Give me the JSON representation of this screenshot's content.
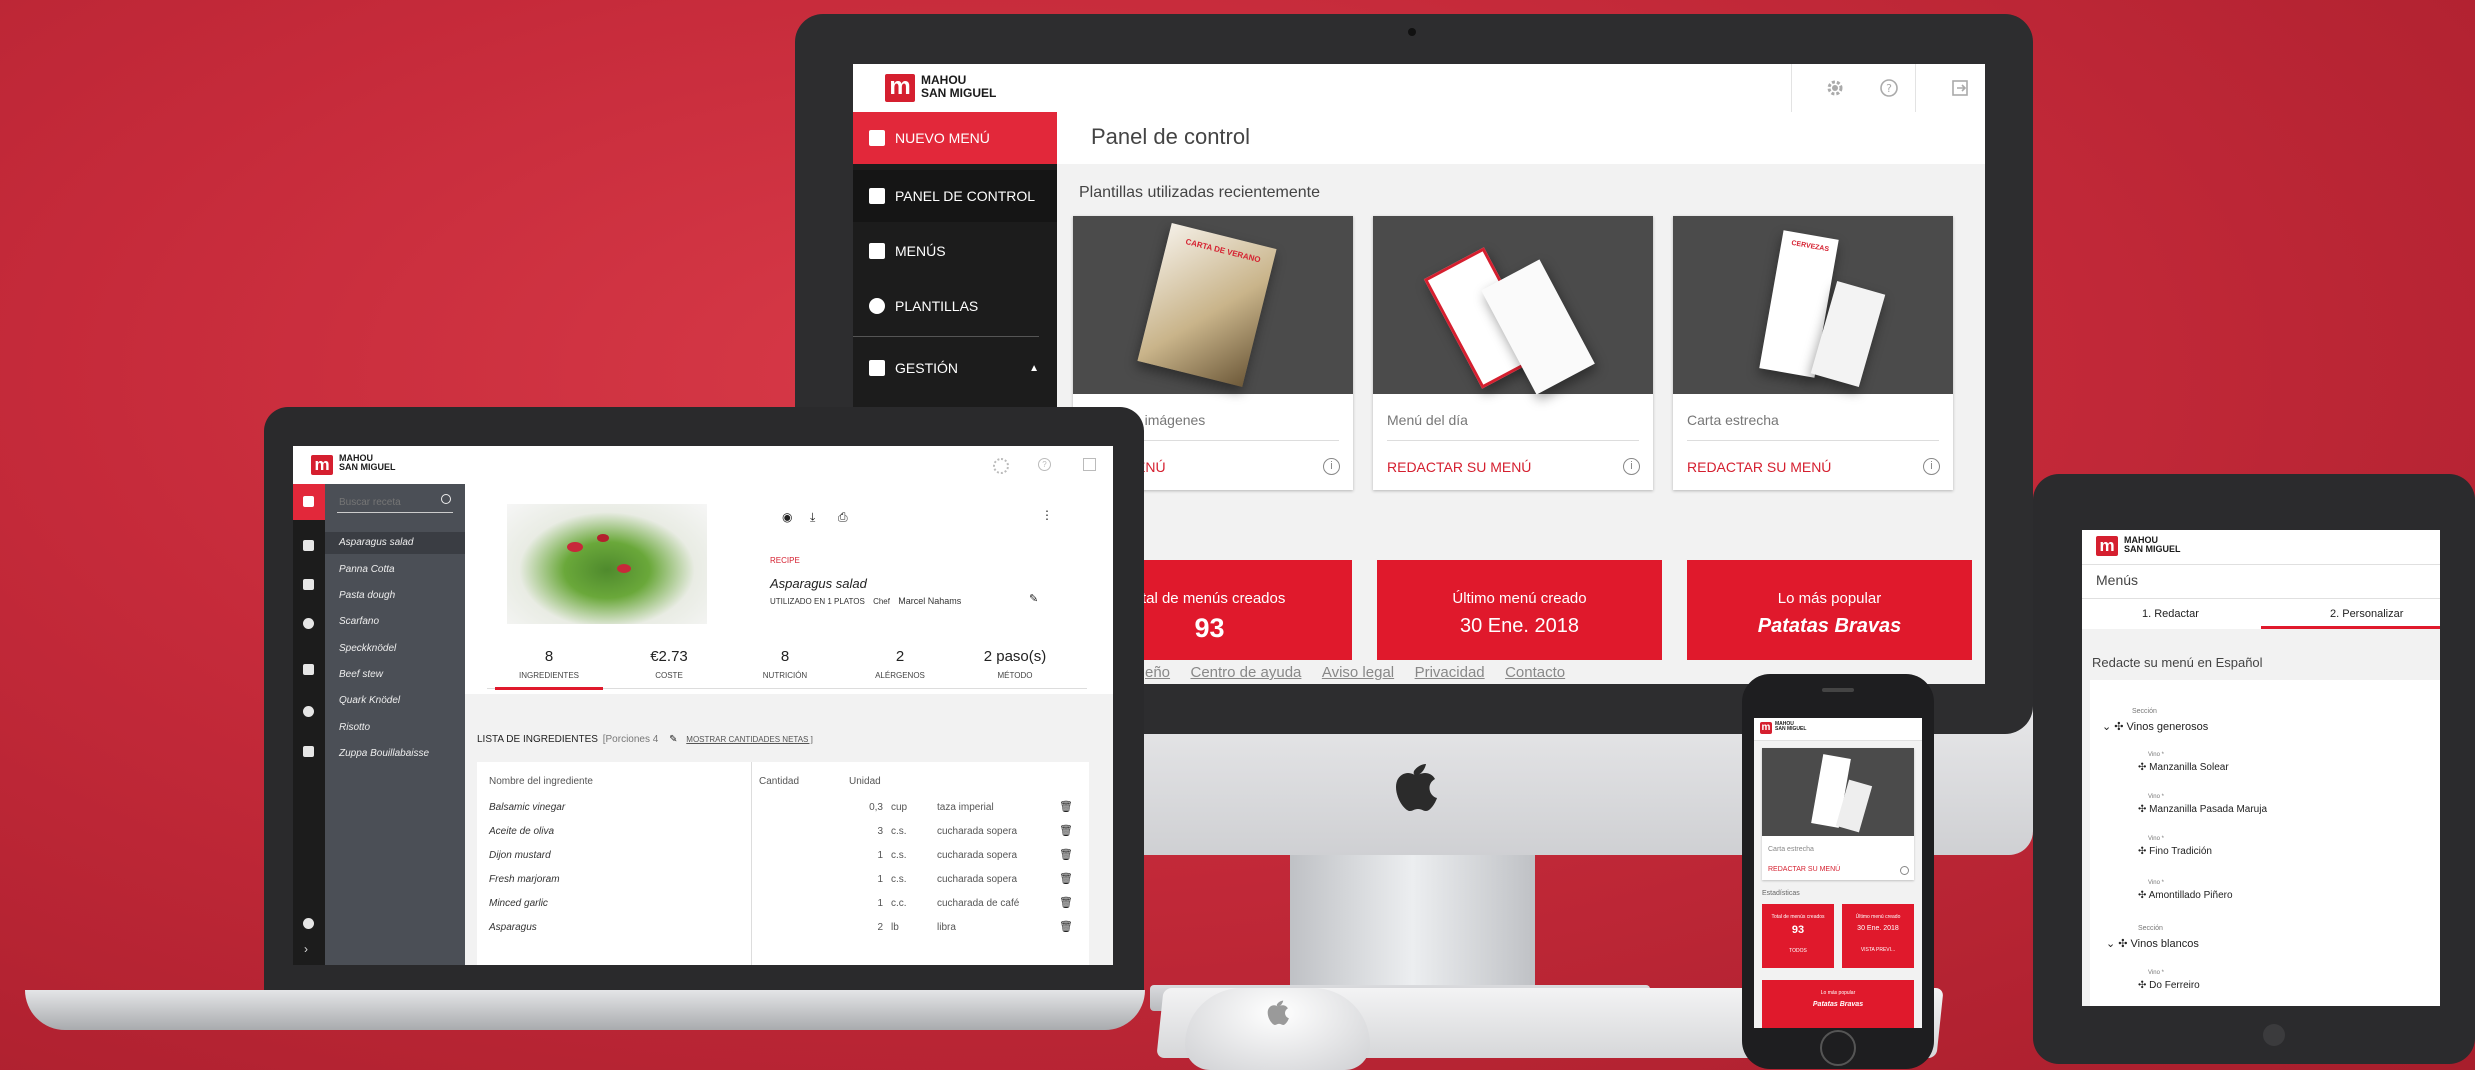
{
  "brand": {
    "line1": "MAHOU",
    "line2": "SAN MIGUEL",
    "mark": "m",
    "red": "#e0192c",
    "dark": "#1c1c1c"
  },
  "desktop": {
    "sidebar": [
      {
        "label": "NUEVO MENÚ",
        "icon": "pencil-icon",
        "active": true
      },
      {
        "label": "PANEL DE CONTROL",
        "icon": "dashboard-icon"
      },
      {
        "label": "MENÚS",
        "icon": "book-icon"
      },
      {
        "label": "PLANTILLAS",
        "icon": "palette-icon"
      },
      {
        "label": "GESTIÓN",
        "icon": "clipboard-icon"
      }
    ],
    "title": "Panel de control",
    "templates_heading": "Plantillas utilizadas recientemente",
    "templates": [
      {
        "name": "Texto e imágenes",
        "shown_name": "o texto e imágenes",
        "link": "R SU MENÚ",
        "image_label": "CARTA DE VERANO"
      },
      {
        "name": "Menú del día",
        "link": "REDACTAR SU MENÚ"
      },
      {
        "name": "Carta estrecha",
        "link": "REDACTAR SU MENÚ",
        "image_label": "CERVEZAS"
      }
    ],
    "stats_heading": "s",
    "stats": [
      {
        "label": "otal de menús creados",
        "value": "93"
      },
      {
        "label": "Último menú creado",
        "value": "30 Ene. 2018"
      },
      {
        "label": "Lo más popular",
        "value": "Patatas Bravas"
      }
    ],
    "footer": [
      "eño",
      "Centro de ayuda",
      "Aviso legal",
      "Privacidad",
      "Contacto"
    ]
  },
  "laptop": {
    "search_placeholder": "Buscar receta",
    "recipes": [
      "Asparagus salad",
      "Panna Cotta",
      "Pasta dough",
      "Scarfano",
      "Speckknödel",
      "Beef stew",
      "Quark Knödel",
      "Risotto",
      "Zuppa Bouillabaisse"
    ],
    "recipe_tag": "RECIPE",
    "recipe_name": "Asparagus salad",
    "used_in": "UTILIZADO EN 1 PLATOS",
    "chef_label": "Chef",
    "chef": "Marcel Nahams",
    "tabs": [
      {
        "value": "8",
        "label": "INGREDIENTES"
      },
      {
        "value": "€2.73",
        "label": "COSTE"
      },
      {
        "value": "8",
        "label": "NUTRICIÓN"
      },
      {
        "value": "2",
        "label": "ALÉRGENOS"
      },
      {
        "value": "2 paso(s)",
        "label": "MÉTODO"
      }
    ],
    "ingredients_title": "LISTA DE INGREDIENTES",
    "portions": "[Porciones 4",
    "show_net": "MOSTRAR CANTIDADES NETAS ]",
    "columns": [
      "Nombre del ingrediente",
      "Cantidad",
      "Unidad"
    ],
    "rows": [
      {
        "name": "Balsamic vinegar",
        "qty": "0,3",
        "unit": "cup",
        "measure": "taza imperial"
      },
      {
        "name": "Aceite de oliva",
        "qty": "3",
        "unit": "c.s.",
        "measure": "cucharada sopera"
      },
      {
        "name": "Dijon mustard",
        "qty": "1",
        "unit": "c.s.",
        "measure": "cucharada sopera"
      },
      {
        "name": "Fresh marjoram",
        "qty": "1",
        "unit": "c.s.",
        "measure": "cucharada sopera"
      },
      {
        "name": "Minced garlic",
        "qty": "1",
        "unit": "c.c.",
        "measure": "cucharada de café"
      },
      {
        "name": "Asparagus",
        "qty": "2",
        "unit": "lb",
        "measure": "libra"
      }
    ]
  },
  "tablet": {
    "title": "Menús",
    "steps": [
      "1. Redactar",
      "2. Personalizar"
    ],
    "heading": "Redacte su menú en Español",
    "section_label": "Sección",
    "wine_label": "Vino *",
    "sections": [
      {
        "name": "Vinos generosos",
        "items": [
          "Manzanilla Solear",
          "Manzanilla Pasada Maruja",
          "Fino Tradición",
          "Amontillado Piñero"
        ]
      },
      {
        "name": "Vinos blancos",
        "items": [
          "Do Ferreiro"
        ]
      }
    ]
  },
  "phone": {
    "card_name": "Carta estrecha",
    "card_link": "REDACTAR SU MENÚ",
    "stats_heading": "Estadísticas",
    "stats": [
      {
        "label": "Total de menús creados",
        "value": "93",
        "action": "TODOS"
      },
      {
        "label": "Último menú creado",
        "value": "30 Ene. 2018",
        "action": "VISTA PREVI..."
      }
    ],
    "popular_label": "Lo más popular",
    "popular_value": "Patatas Bravas"
  }
}
